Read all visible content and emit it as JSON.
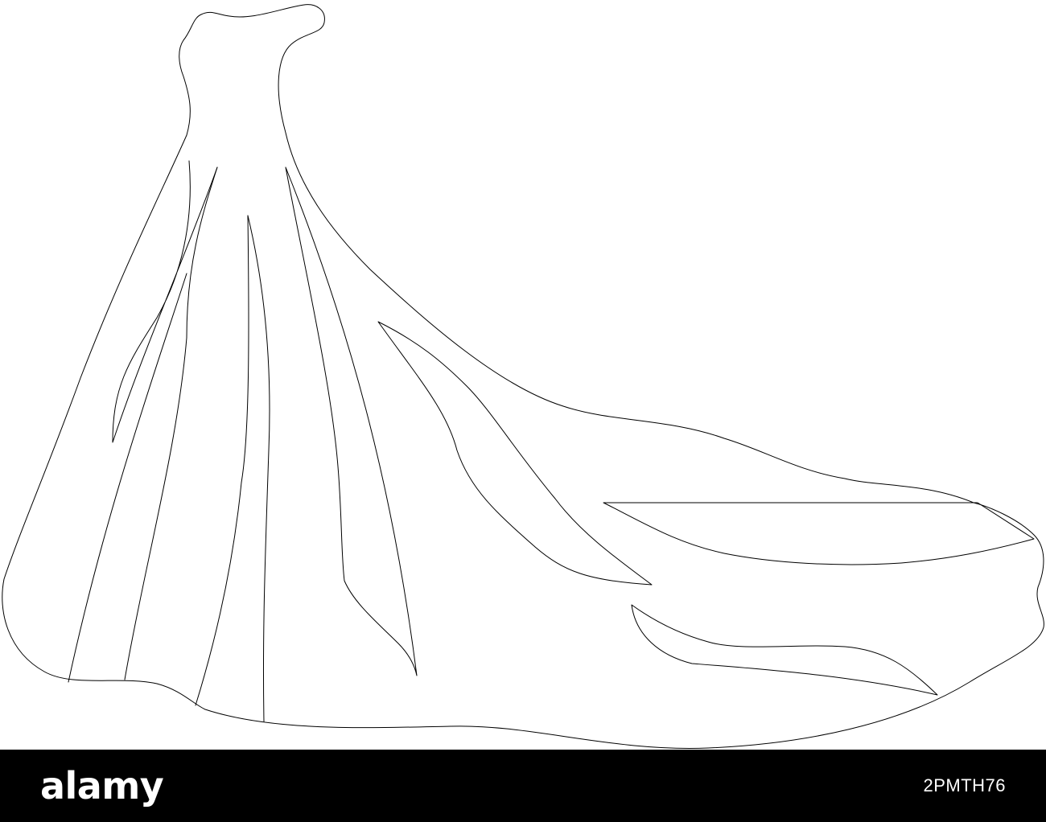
{
  "watermark": {
    "brand": "alamy",
    "image_id": "2PMTH76"
  },
  "colors": {
    "background": "#ffffff",
    "line_art": "#000000",
    "banner": "#000000",
    "banner_text": "#ffffff"
  }
}
